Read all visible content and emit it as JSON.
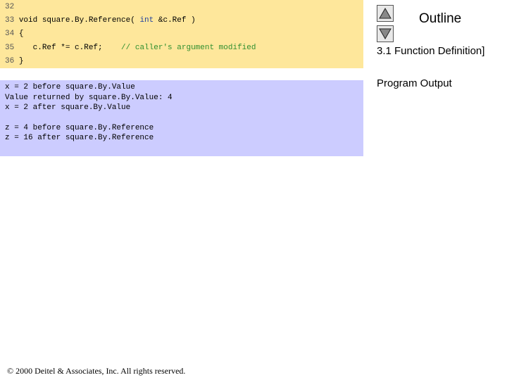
{
  "code": {
    "lines": [
      {
        "num": "32",
        "text": ""
      },
      {
        "num": "33",
        "pre": "void square.By.Reference( ",
        "kw": "int",
        "post": " &c.Ref )"
      },
      {
        "num": "34",
        "text": "{"
      },
      {
        "num": "35",
        "text": "   c.Ref *= c.Ref;",
        "comment": "// caller's argument modified"
      },
      {
        "num": "36",
        "text": "}"
      }
    ]
  },
  "output": {
    "lines": [
      "x = 2 before square.By.Value",
      "Value returned by square.By.Value: 4",
      "x = 2 after square.By.Value",
      "",
      "z = 4 before square.By.Reference",
      "z = 16 after square.By.Reference"
    ]
  },
  "sidebar": {
    "title": "Outline",
    "prev_icon": "triangle-up-icon",
    "next_icon": "triangle-down-icon",
    "items": [
      "3.1 Function Definition]",
      "Program Output"
    ]
  },
  "footer": {
    "copyright_symbol": "©",
    "text": " 2000 Deitel & Associates, Inc.  All rights reserved."
  }
}
